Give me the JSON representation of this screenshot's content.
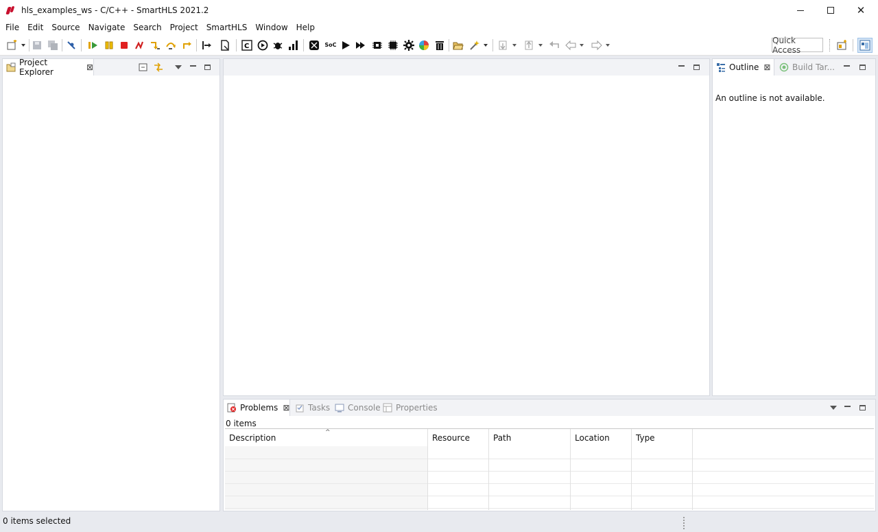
{
  "window": {
    "title": "hls_examples_ws - C/C++ - SmartHLS 2021.2",
    "minimize": "minimize",
    "maximize": "maximize",
    "close": "✕"
  },
  "menu": [
    "File",
    "Edit",
    "Source",
    "Navigate",
    "Search",
    "Project",
    "SmartHLS",
    "Window",
    "Help"
  ],
  "toolbar": {
    "soc_label": "SoC",
    "quick_access": "Quick Access",
    "icons": [
      "new-icon",
      "save-icon",
      "save-all-icon",
      "skip-breakpoints-icon",
      "resume-icon",
      "suspend-icon",
      "terminate-icon",
      "disconnect-icon",
      "step-into-icon",
      "step-over-icon",
      "step-return-icon",
      "drop-to-frame-icon",
      "open-file-icon",
      "compile-icon",
      "run-icon",
      "debug-icon",
      "profile-icon",
      "build-icon",
      "soc-icon",
      "play-icon",
      "fast-forward-icon",
      "chip-icon",
      "chip-black-icon",
      "gear-icon",
      "color-wheel-icon",
      "trash-icon",
      "open-folder-icon",
      "search-wand-icon",
      "next-annotation-icon",
      "prev-annotation-icon",
      "last-edit-icon",
      "back-icon",
      "forward-icon",
      "open-perspective-icon",
      "cpp-perspective-icon"
    ]
  },
  "project_explorer": {
    "tab_label": "Project Explorer"
  },
  "outline": {
    "tab_label": "Outline",
    "build_targets_label": "Build Tar...",
    "message": "An outline is not available."
  },
  "problems": {
    "tabs": [
      {
        "label": "Problems",
        "active": true
      },
      {
        "label": "Tasks",
        "active": false
      },
      {
        "label": "Console",
        "active": false
      },
      {
        "label": "Properties",
        "active": false
      }
    ],
    "items_count": "0 items",
    "columns": [
      "Description",
      "Resource",
      "Path",
      "Location",
      "Type"
    ]
  },
  "status": {
    "text": "0 items selected"
  },
  "colors": {
    "background": "#e8eaef",
    "panel": "#ffffff",
    "accent_red": "#c8102e"
  }
}
